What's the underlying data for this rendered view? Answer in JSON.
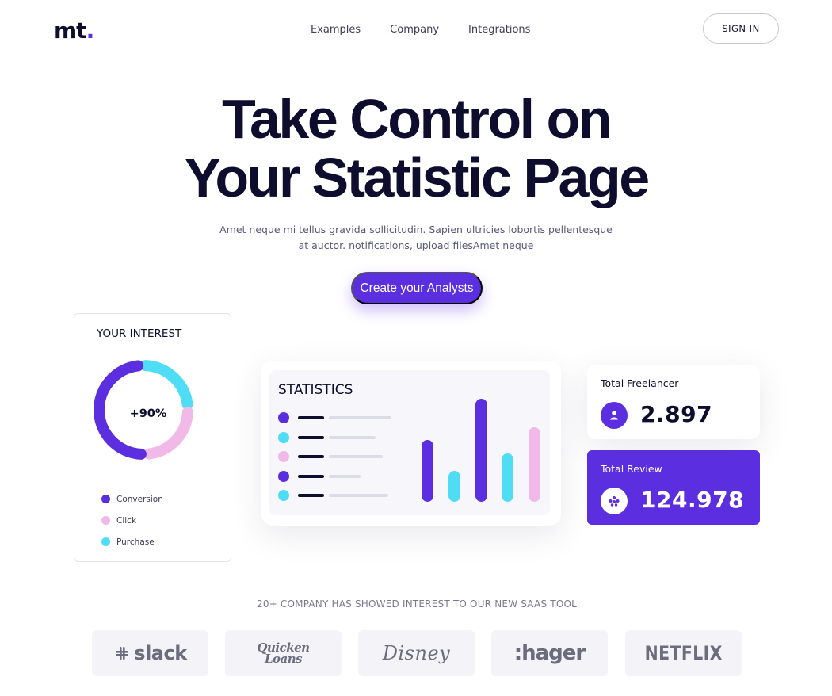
{
  "brand": {
    "logo_text": "mt",
    "logo_dot": ".",
    "accent": "#5b2ee0"
  },
  "nav": {
    "items": [
      "Examples",
      "Company",
      "Integrations"
    ],
    "signin_label": "SIGN IN"
  },
  "hero": {
    "title_line1": "Take Control on",
    "title_line2": "Your Statistic Page",
    "subtitle": "Amet neque mi tellus gravida sollicitudin. Sapien ultricies lobortis pellentesque at auctor. notifications, upload filesAmet neque",
    "cta_label": "Create your Analysts"
  },
  "interest": {
    "title": "YOUR INTEREST",
    "center_label": "+90%",
    "segments": [
      {
        "name": "Conversion",
        "fraction": 0.5,
        "color": "#5b2ee0"
      },
      {
        "name": "Purchase",
        "fraction": 0.25,
        "color": "#4fdcf5"
      },
      {
        "name": "Click",
        "fraction": 0.25,
        "color": "#f1b9e8"
      }
    ],
    "legend": [
      {
        "label": "Conversion",
        "color": "#5b2ee0"
      },
      {
        "label": "Click",
        "color": "#f1b9e8"
      },
      {
        "label": "Purchase",
        "color": "#4fdcf5"
      }
    ]
  },
  "statistics": {
    "title": "STATISTICS",
    "rows": [
      {
        "color": "#5b2ee0",
        "level": 1.0
      },
      {
        "color": "#4fdcf5",
        "level": 0.75
      },
      {
        "color": "#f1b9e8",
        "level": 0.86
      },
      {
        "color": "#5b2ee0",
        "level": 0.51
      },
      {
        "color": "#4fdcf5",
        "level": 0.95
      }
    ],
    "bars": [
      {
        "color": "#5b2ee0",
        "level": 0.6
      },
      {
        "color": "#4fdcf5",
        "level": 0.3
      },
      {
        "color": "#5b2ee0",
        "level": 1.0
      },
      {
        "color": "#4fdcf5",
        "level": 0.47
      },
      {
        "color": "#f1b9e8",
        "level": 0.72
      }
    ]
  },
  "metrics": {
    "freelancer": {
      "label": "Total Freelancer",
      "value": "2.897",
      "icon": "user-icon"
    },
    "review": {
      "label": "Total Review",
      "value": "124.978",
      "icon": "community-icon"
    }
  },
  "companies": {
    "heading": "20+ COMPANY HAS SHOWED INTEREST TO OUR NEW SAAS TOOL",
    "logos": [
      {
        "name": "slack",
        "text": "slack"
      },
      {
        "name": "quicken-loans",
        "text_line1": "Quicken",
        "text_line2": "Loans"
      },
      {
        "name": "disney",
        "text": "Disney"
      },
      {
        "name": "hager",
        "text": ":hager"
      },
      {
        "name": "netflix",
        "text": "NETFLIX"
      }
    ]
  }
}
